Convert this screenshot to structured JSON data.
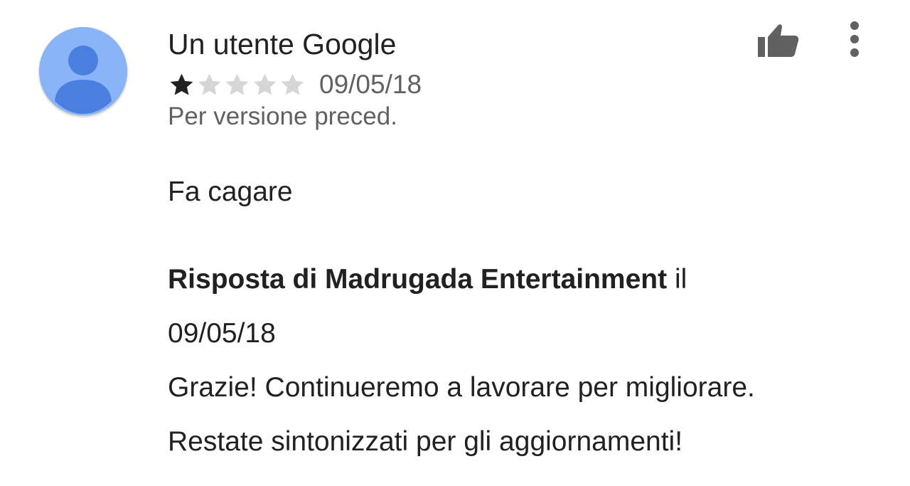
{
  "review": {
    "author": "Un utente Google",
    "rating": 1,
    "rating_max": 5,
    "date": "09/05/18",
    "version_note": "Per versione preced.",
    "text": "Fa cagare"
  },
  "reply": {
    "prefix": "Risposta di",
    "developer": "Madrugada Entertainment",
    "connector": "il",
    "date": "09/05/18",
    "line1": "Grazie! Continueremo a lavorare per migliorare.",
    "line2": "Restate sintonizzati per gli aggiornamenti!"
  },
  "icons": {
    "avatar": "default-user-avatar-icon",
    "thumb": "thumb-up-icon",
    "menu": "more-vert-icon",
    "star": "star-icon"
  },
  "colors": {
    "avatar_bg": "#8ab4f8",
    "avatar_figure": "#4a7fe0",
    "star_filled": "#212121",
    "star_empty": "#d6d6d6",
    "icon_gray": "#616161"
  }
}
